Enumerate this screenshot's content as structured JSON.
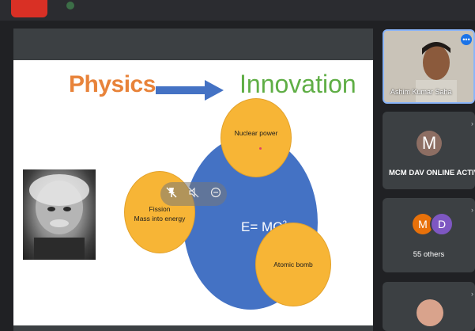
{
  "slide": {
    "title_left": "Physics",
    "title_right": "Innovation",
    "center_text": "E= MC",
    "center_sup": "2",
    "top_circle": "Nuclear power",
    "left_circle_line1": "Fission",
    "left_circle_line2": "Mass into energy",
    "bottom_circle": "Atomic bomb"
  },
  "participants": {
    "speaker_name": "Ashim Kumar Saha",
    "m_tile_initial": "M",
    "m_tile_label": "MCM DAV ONLINE ACTIVI...",
    "others_initial_1": "M",
    "others_initial_2": "D",
    "others_label": "55 others"
  },
  "colors": {
    "physics": "#e8833a",
    "innovation": "#5fae45",
    "center_circle": "#4472c4",
    "satellite_circle": "#f7b536"
  },
  "icons": {
    "overlay": [
      "pin-off-icon",
      "mute-icon",
      "remove-icon"
    ]
  }
}
